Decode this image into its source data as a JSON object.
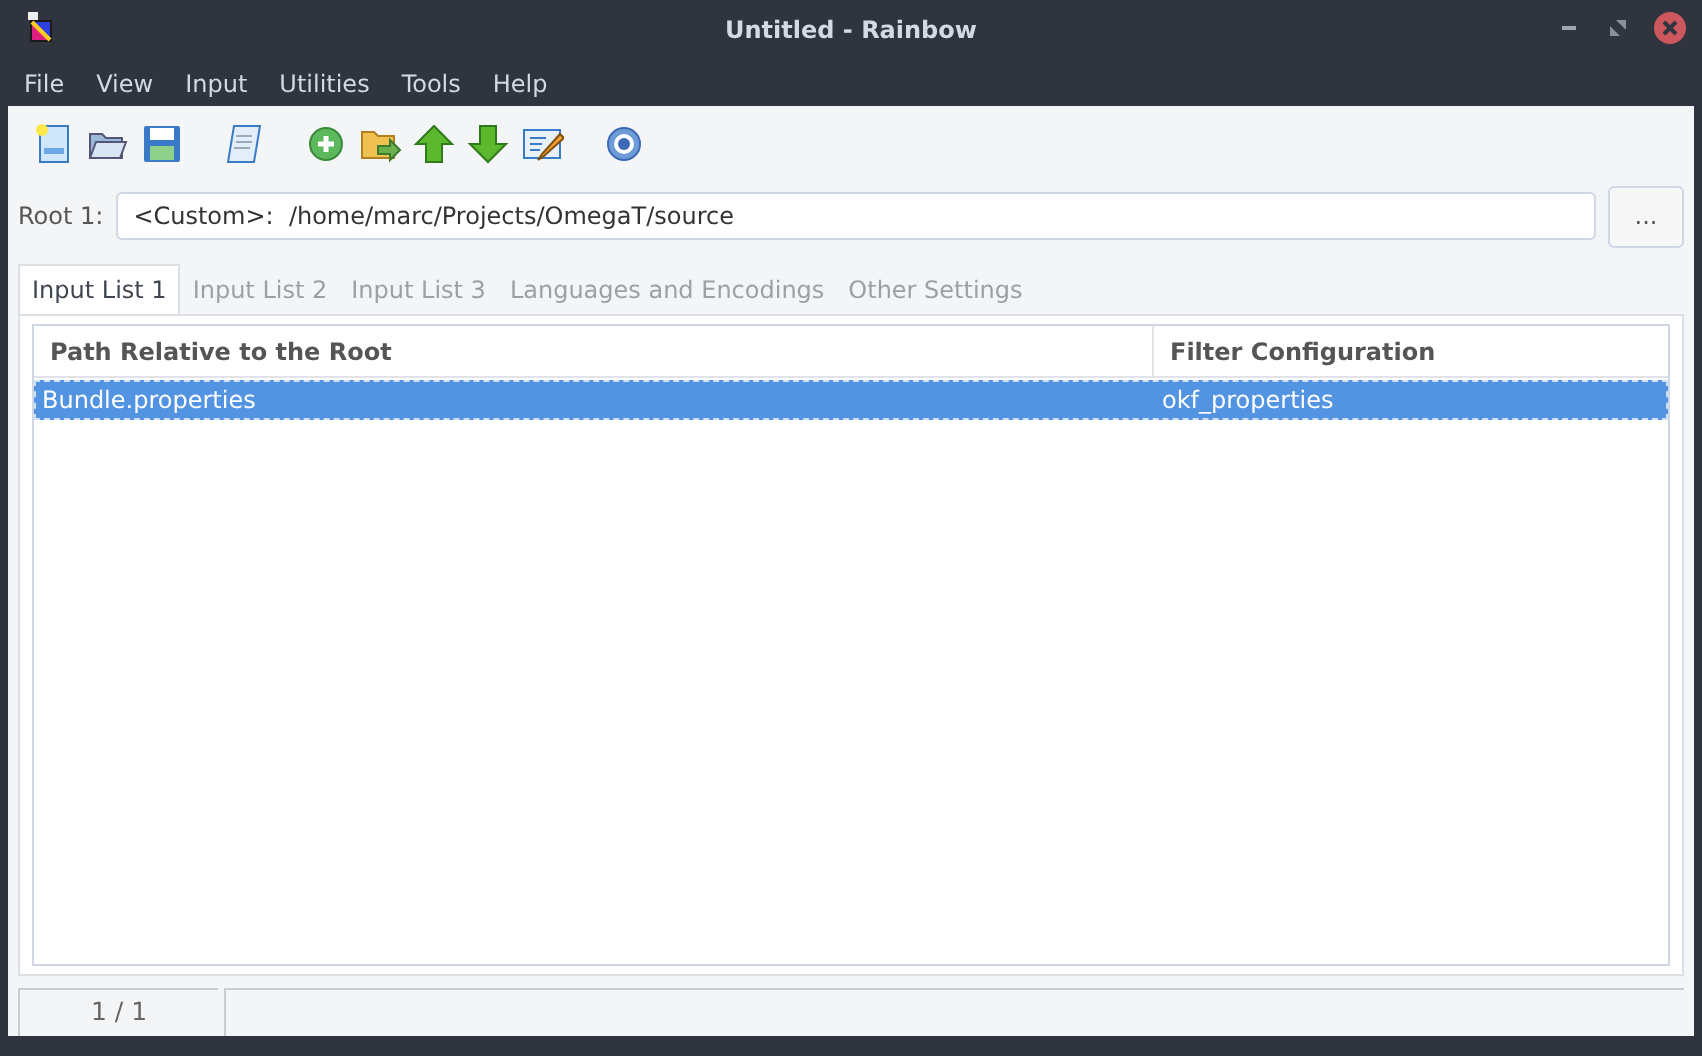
{
  "window": {
    "title": "Untitled - Rainbow"
  },
  "menu": [
    "File",
    "View",
    "Input",
    "Utilities",
    "Tools",
    "Help"
  ],
  "toolbar": [
    {
      "items": [
        {
          "kind": "new"
        },
        {
          "kind": "open"
        },
        {
          "kind": "save"
        }
      ]
    },
    {
      "items": [
        {
          "kind": "script"
        }
      ]
    },
    {
      "items": [
        {
          "kind": "add"
        },
        {
          "kind": "folder-arrow"
        },
        {
          "kind": "up"
        },
        {
          "kind": "down"
        },
        {
          "kind": "edit"
        }
      ]
    },
    {
      "items": [
        {
          "kind": "help"
        }
      ]
    }
  ],
  "root": {
    "label": "Root 1:",
    "value": "<Custom>:  /home/marc/Projects/OmegaT/source",
    "button": "..."
  },
  "tabs": [
    {
      "label": "Input List 1",
      "selected": true
    },
    {
      "label": "Input List 2",
      "selected": false
    },
    {
      "label": "Input List 3",
      "selected": false
    },
    {
      "label": "Languages and Encodings",
      "selected": false
    },
    {
      "label": "Other Settings",
      "selected": false
    }
  ],
  "table": {
    "columns": [
      "Path Relative to the Root",
      "Filter Configuration"
    ],
    "rows": [
      {
        "cells": [
          "Bundle.properties",
          "okf_properties"
        ],
        "selected": true
      }
    ]
  },
  "status_bar": [
    "1 / 1"
  ]
}
